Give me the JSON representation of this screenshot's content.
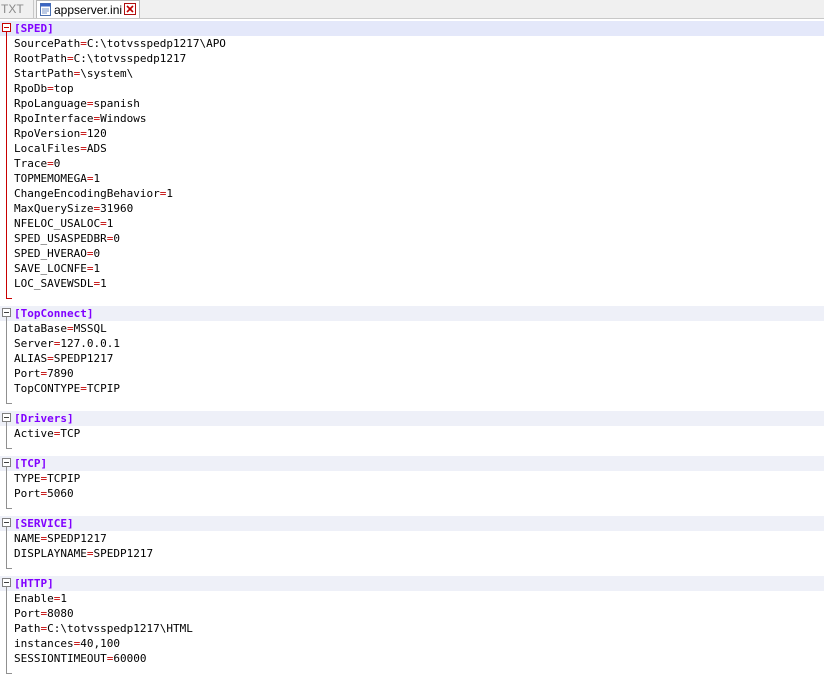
{
  "tabs": [
    {
      "label": "TXT",
      "active": false
    },
    {
      "label": "appserver.ini",
      "active": true
    }
  ],
  "sections": [
    {
      "name": "[SPED]",
      "current": true,
      "entries": [
        {
          "key": "SourcePath",
          "value": "C:\\totvsspedp1217\\APO"
        },
        {
          "key": "RootPath",
          "value": "C:\\totvsspedp1217"
        },
        {
          "key": "StartPath",
          "value": "\\system\\"
        },
        {
          "key": "RpoDb",
          "value": "top"
        },
        {
          "key": "RpoLanguage",
          "value": "spanish"
        },
        {
          "key": "RpoInterface",
          "value": "Windows"
        },
        {
          "key": "RpoVersion",
          "value": "120"
        },
        {
          "key": "LocalFiles",
          "value": "ADS"
        },
        {
          "key": "Trace",
          "value": "0"
        },
        {
          "key": "TOPMEMOMEGA",
          "value": "1"
        },
        {
          "key": "ChangeEncodingBehavior",
          "value": "1"
        },
        {
          "key": "MaxQuerySize",
          "value": "31960"
        },
        {
          "key": "NFELOC_USALOC",
          "value": "1"
        },
        {
          "key": "SPED_USASPEDBR",
          "value": "0"
        },
        {
          "key": "SPED_HVERAO",
          "value": "0"
        },
        {
          "key": "SAVE_LOCNFE",
          "value": "1"
        },
        {
          "key": "LOC_SAVEWSDL",
          "value": "1"
        }
      ]
    },
    {
      "name": "[TopConnect]",
      "current": false,
      "entries": [
        {
          "key": "DataBase",
          "value": "MSSQL"
        },
        {
          "key": "Server",
          "value": "127.0.0.1"
        },
        {
          "key": "ALIAS",
          "value": "SPEDP1217"
        },
        {
          "key": "Port",
          "value": "7890"
        },
        {
          "key": "TopCONTYPE",
          "value": "TCPIP"
        }
      ]
    },
    {
      "name": "[Drivers]",
      "current": false,
      "entries": [
        {
          "key": "Active",
          "value": "TCP"
        }
      ]
    },
    {
      "name": "[TCP]",
      "current": false,
      "entries": [
        {
          "key": "TYPE",
          "value": "TCPIP"
        },
        {
          "key": "Port",
          "value": "5060"
        }
      ]
    },
    {
      "name": "[SERVICE]",
      "current": false,
      "entries": [
        {
          "key": "NAME",
          "value": "SPEDP1217"
        },
        {
          "key": "DISPLAYNAME",
          "value": "SPEDP1217"
        }
      ]
    },
    {
      "name": "[HTTP]",
      "current": false,
      "entries": [
        {
          "key": "Enable",
          "value": "1"
        },
        {
          "key": "Port",
          "value": "8080"
        },
        {
          "key": "Path",
          "value": "C:\\totvsspedp1217\\HTML"
        },
        {
          "key": "instances",
          "value": "40,100"
        },
        {
          "key": "SESSIONTIMEOUT",
          "value": "60000"
        }
      ]
    }
  ],
  "colors": {
    "section_text": "#8000ff",
    "operator": "#c00000",
    "fold_current": "#c80000",
    "section_band": "#eef0f8"
  },
  "icons": {
    "file_tab": "notepad-file-icon",
    "close_tab": "red-close-icon",
    "fold": "fold-minus-icon"
  }
}
